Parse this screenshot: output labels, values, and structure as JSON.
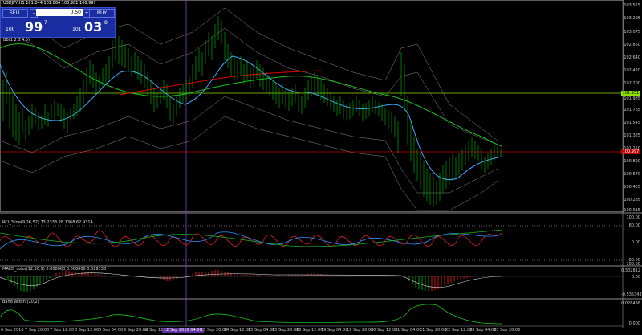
{
  "chart": {
    "symbol_title": "USDJPY,H1",
    "ohlc": "101.044 101.064 100.981 100.997",
    "price_labels": [
      "103.515",
      "103.295",
      "103.075",
      "102.860",
      "102.640",
      "102.420",
      "102.200",
      "101.985",
      "101.765",
      "101.545",
      "101.325",
      "101.110",
      "100.890",
      "100.670",
      "100.455",
      "100.235",
      "100.015"
    ],
    "current_price_badge": "100.997",
    "level_badge": "101.931",
    "x_labels": [
      "6 Sep 2016",
      "7 Sep 20:00",
      "7 Sep 12:00",
      "8 Sep 12:00",
      "9 Sep 04:00",
      "9 Sep 20:00",
      "12 Sep 12:00",
      "13 Sep 04:00",
      "13 Sep 20:00",
      "14 Sep 12:00",
      "15 Sep 04:00",
      "15 Sep 20:00",
      "16 Sep 12:00",
      "19 Sep 04:00",
      "19 Sep 20:00",
      "20 Sep 12:00",
      "21 Sep 04:00",
      "21 Sep 20:00",
      "22 Sep 12:00",
      "23 Sep 04:00",
      "23 Sep 20:00"
    ],
    "cursor_label": "12 Sep 2016 04:00"
  },
  "trade_panel": {
    "sell_label": "SELL",
    "buy_label": "BUY",
    "lot_value": "0.50",
    "sell_big": "99",
    "sell_small": "100",
    "sell_sup": "7",
    "buy_big": "03",
    "buy_small": "101",
    "buy_sup": "8",
    "minus": "-",
    "plus": "+"
  },
  "indicators": {
    "chart_indicator_label": "BB(1 2 3 4 5)",
    "rci_label": "RCI_3line(9,26,52) 73.2333 28.1368 62.9314",
    "rci_levels": [
      "100.00",
      "80.00",
      "0.00",
      "-80.00",
      "-100.00"
    ],
    "macd_label": "MACD_color(12,26,9) 0.000000 0.000000 0.029138",
    "macd_levels": [
      "0.302812",
      "0.00",
      "-0.535343"
    ],
    "bw_label": "Band Width (20,2)",
    "bw_levels": [
      "0.028436",
      "0.000"
    ]
  },
  "colors": {
    "bull": "#00c000",
    "bear": "#ff2020",
    "ma_red": "#e00000",
    "ma_green": "#20c020",
    "ma_blue": "#40a8ff",
    "bb": "#909090",
    "level_line": "#90e000",
    "price_line": "#c00000",
    "cursor": "#8040c0"
  }
}
